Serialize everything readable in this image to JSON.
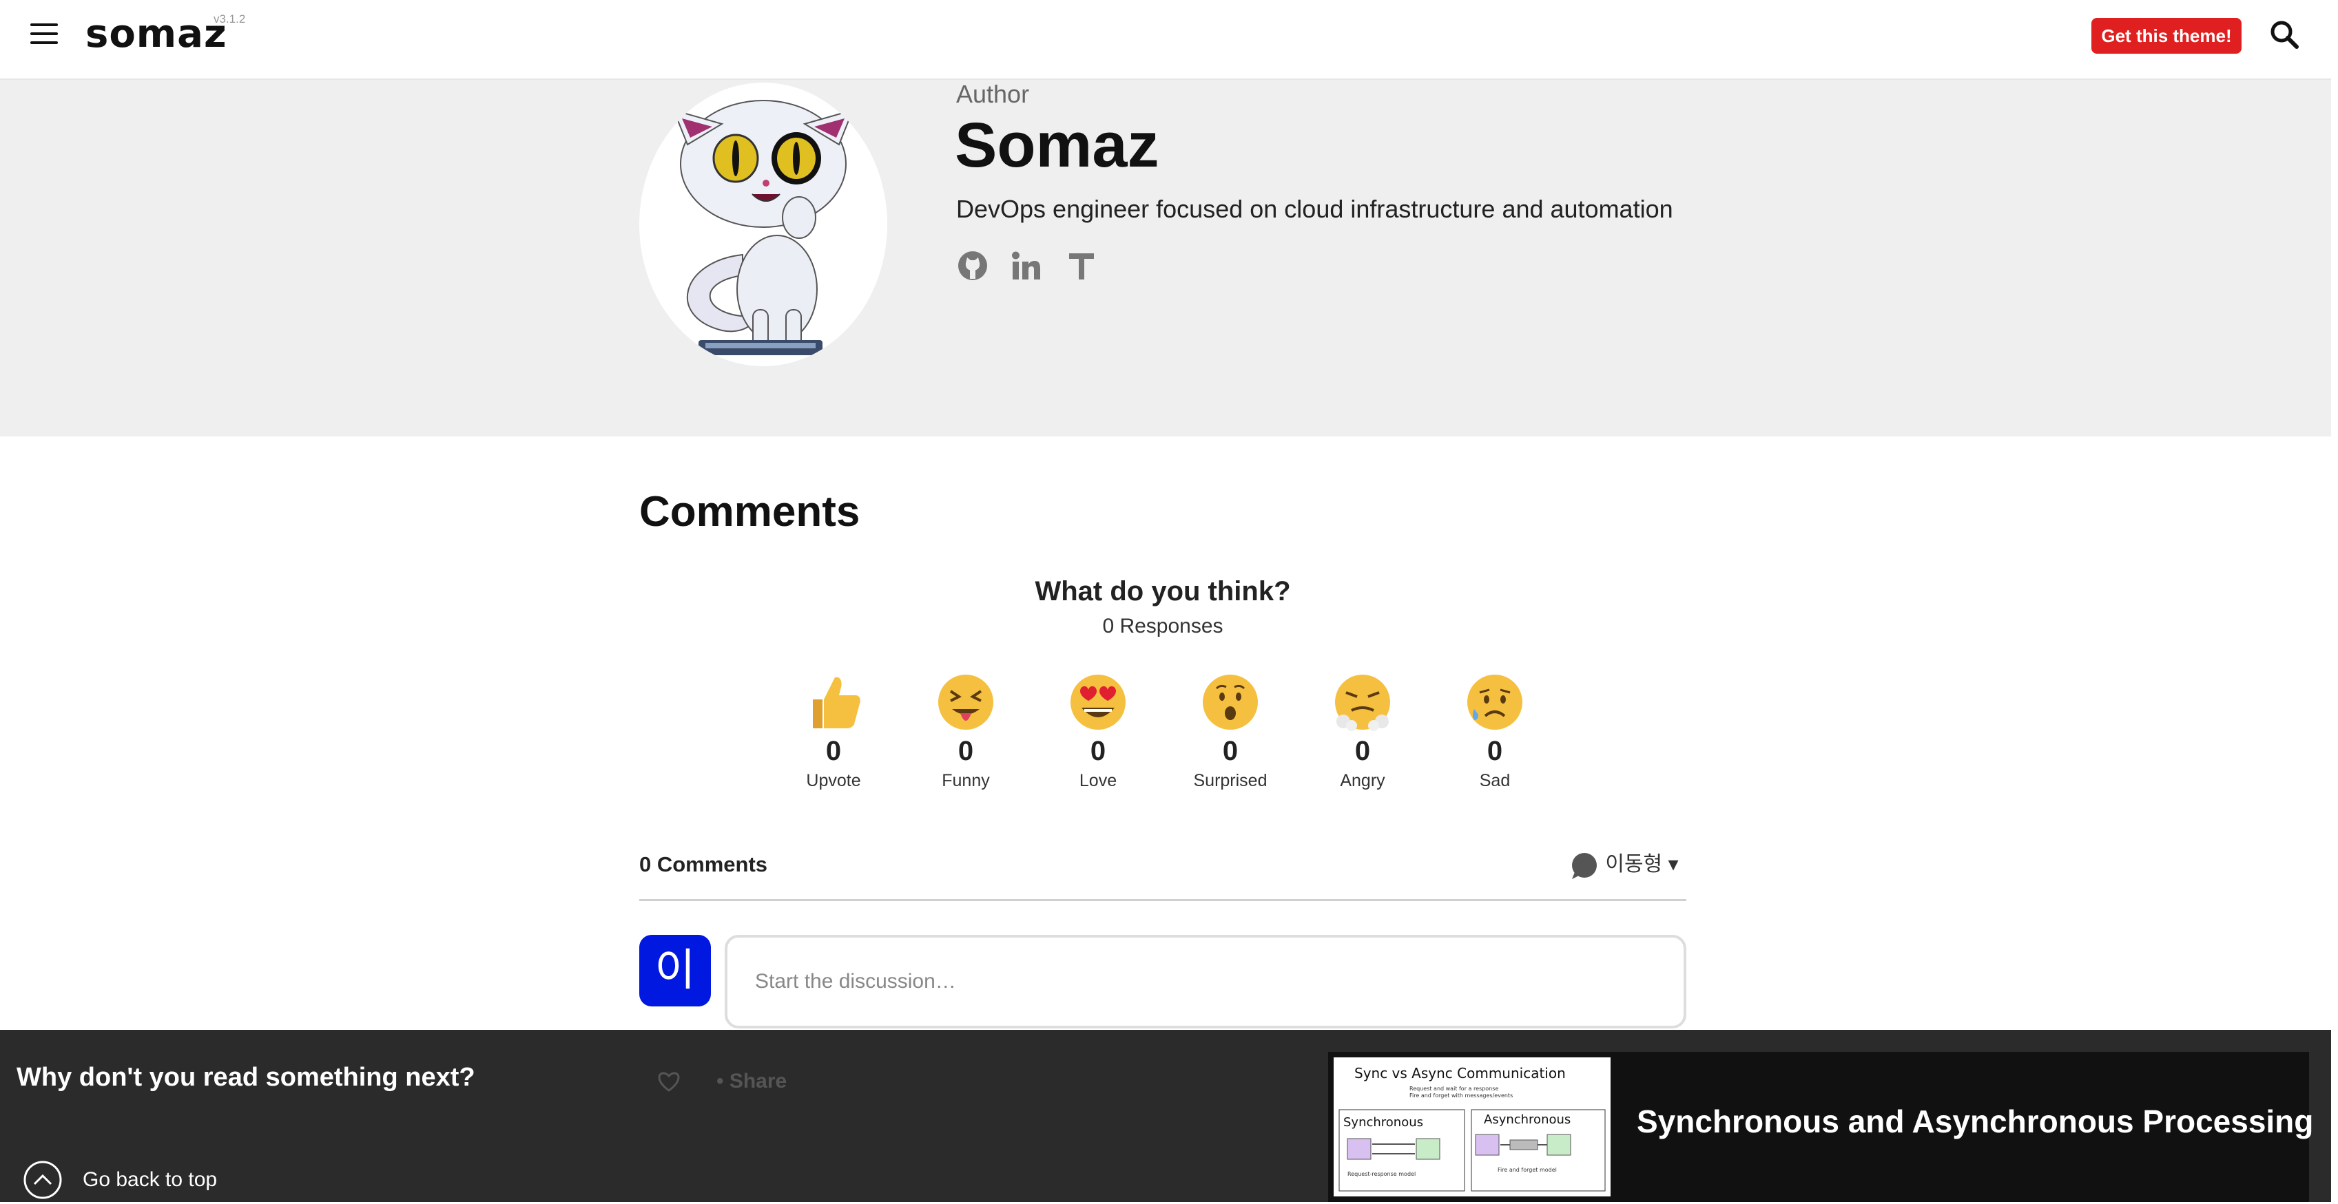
{
  "header": {
    "logo": "somaz",
    "version": "v3.1.2",
    "cta_label": "Get this theme!"
  },
  "author": {
    "label": "Author",
    "name": "Somaz",
    "bio": "DevOps engineer focused on cloud infrastructure and automation",
    "social": [
      "github-icon",
      "linkedin-icon",
      "tistory-icon"
    ]
  },
  "comments": {
    "title": "Comments",
    "prompt": "What do you think?",
    "responses": "0 Responses",
    "reactions": [
      {
        "label": "Upvote",
        "count": "0",
        "icon": "thumbs-up-icon"
      },
      {
        "label": "Funny",
        "count": "0",
        "icon": "squinting-tongue-face-icon"
      },
      {
        "label": "Love",
        "count": "0",
        "icon": "heart-eyes-face-icon"
      },
      {
        "label": "Surprised",
        "count": "0",
        "icon": "surprised-face-icon"
      },
      {
        "label": "Angry",
        "count": "0",
        "icon": "steam-nose-face-icon"
      },
      {
        "label": "Sad",
        "count": "0",
        "icon": "sad-sweat-face-icon"
      }
    ],
    "count_label": "0 Comments",
    "user_name": "이동형",
    "user_initial": "이",
    "input_placeholder": "Start the discussion…",
    "share_label": "Share"
  },
  "read_next": {
    "heading": "Why don't you read something next?",
    "back_to_top": "Go back to top",
    "post_title": "Synchronous and Asynchronous Processing",
    "thumb": {
      "title": "Sync vs Async Communication",
      "subtitle1": "Request and wait for a response",
      "subtitle2": "Fire and forget with messages/events",
      "sync_label": "Synchronous",
      "async_label": "Asynchronous",
      "sync_caption": "Request-response model",
      "async_caption": "Fire and forget model"
    }
  },
  "colors": {
    "accent": "#e02020",
    "author_band": "#efefef",
    "user_avatar": "#0018e0",
    "bottom_bar": "#2b2b2b"
  }
}
